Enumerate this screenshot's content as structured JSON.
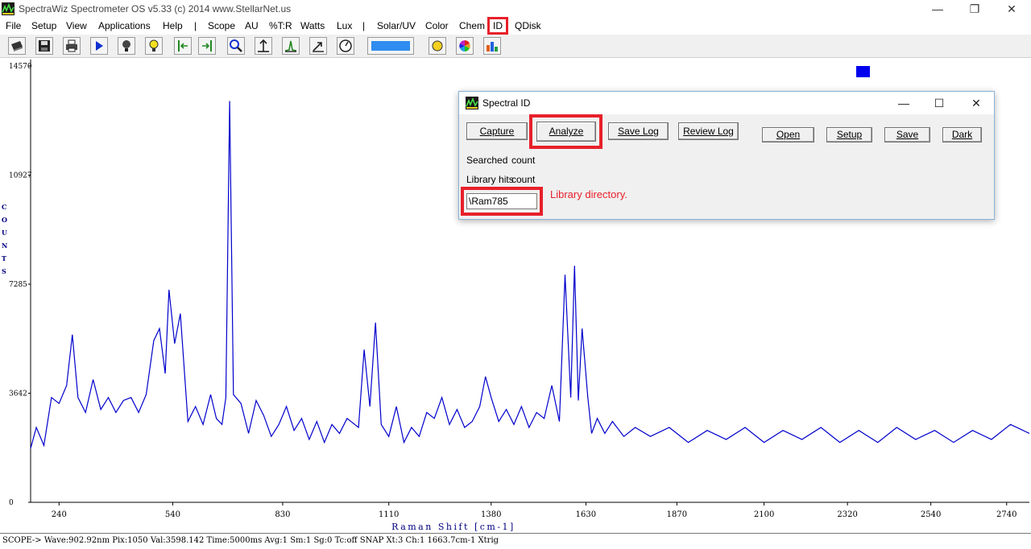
{
  "window": {
    "title": "SpectraWiz  Spectrometer OS v5.33 (c) 2014    www.StellarNet.us",
    "minimize_glyph": "—",
    "restore_glyph": "❐",
    "close_glyph": "✕"
  },
  "menu": {
    "items": [
      "File",
      "Setup",
      "View",
      "Applications",
      "Help",
      "|",
      "Scope",
      "AU",
      "%T:R",
      "Watts",
      "Lux",
      "|",
      "Solar/UV",
      "Color",
      "Chem",
      "ID",
      "QDisk"
    ],
    "highlighted": "ID"
  },
  "toolbar": {
    "icons": [
      "open-icon",
      "save-icon",
      "print-icon",
      "play-icon",
      "lamp-icon",
      "bulb-icon",
      "cursor-left-icon",
      "cursor-right-icon",
      "zoom-icon",
      "autoscale-icon",
      "peak-icon",
      "scale-up-icon",
      "gauge-icon",
      "color-bar-icon",
      "sun-icon",
      "color-wheel-icon",
      "chart-icon"
    ],
    "color_bar": "#2f8cf0"
  },
  "chart_data": {
    "type": "line",
    "xlabel": "Raman Shift [cm-1]",
    "ylabel": "COUNTS",
    "xlim": [
      165,
      2800
    ],
    "ylim": [
      0,
      14570
    ],
    "x_ticks": [
      240,
      540,
      830,
      1110,
      1380,
      1630,
      1870,
      2100,
      2320,
      2540,
      2740
    ],
    "y_ticks": [
      0,
      3642,
      7285,
      10927,
      14570
    ],
    "grid": false,
    "series": [
      {
        "color": "#0000cc",
        "x": [
          165,
          180,
          200,
          220,
          240,
          260,
          275,
          290,
          310,
          330,
          350,
          370,
          390,
          410,
          430,
          450,
          470,
          490,
          505,
          520,
          530,
          545,
          560,
          580,
          600,
          620,
          640,
          655,
          670,
          680,
          690,
          700,
          720,
          740,
          760,
          780,
          800,
          820,
          840,
          860,
          880,
          900,
          920,
          940,
          960,
          980,
          1000,
          1030,
          1045,
          1060,
          1075,
          1090,
          1110,
          1130,
          1150,
          1170,
          1190,
          1210,
          1230,
          1250,
          1270,
          1290,
          1310,
          1330,
          1350,
          1365,
          1380,
          1400,
          1420,
          1440,
          1460,
          1480,
          1500,
          1520,
          1540,
          1560,
          1575,
          1590,
          1600,
          1610,
          1620,
          1635,
          1645,
          1660,
          1680,
          1700,
          1730,
          1760,
          1800,
          1850,
          1900,
          1950,
          2000,
          2050,
          2100,
          2150,
          2200,
          2250,
          2300,
          2350,
          2400,
          2450,
          2500,
          2550,
          2600,
          2650,
          2700,
          2750,
          2800
        ],
        "values": [
          1800,
          2500,
          1900,
          3500,
          3300,
          3900,
          5600,
          3500,
          3000,
          4100,
          3100,
          3500,
          3000,
          3400,
          3500,
          3000,
          3600,
          5400,
          5800,
          4300,
          7100,
          5300,
          6300,
          2700,
          3200,
          2600,
          3600,
          2800,
          2600,
          3500,
          13400,
          3600,
          3300,
          2300,
          3400,
          2900,
          2200,
          2600,
          3200,
          2400,
          2800,
          2100,
          2700,
          2000,
          2600,
          2300,
          2800,
          2500,
          5100,
          3200,
          6000,
          2600,
          2200,
          3200,
          2000,
          2500,
          2200,
          3000,
          2800,
          3500,
          2600,
          3100,
          2500,
          2700,
          3200,
          4200,
          3500,
          2700,
          3100,
          2600,
          3200,
          2500,
          3000,
          2800,
          3900,
          2700,
          7600,
          3500,
          7900,
          3400,
          5800,
          3500,
          2300,
          2800,
          2300,
          2700,
          2200,
          2500,
          2200,
          2500,
          2000,
          2400,
          2100,
          2500,
          2000,
          2400,
          2100,
          2500,
          2000,
          2400,
          2000,
          2500,
          2100,
          2400,
          2000,
          2400,
          2100,
          2600,
          2300
        ]
      }
    ]
  },
  "marker_color": "#0000ee",
  "status": {
    "text": "SCOPE->  Wave:902.92nm  Pix:1050  Val:3598.142  Time:5000ms  Avg:1  Sm:1  Sg:0  Tc:off  SNAP  Xt:3  Ch:1   1663.7cm-1 Xtrig"
  },
  "dialog": {
    "title": "Spectral ID",
    "buttons": {
      "capture": "Capture",
      "analyze": "Analyze",
      "save_log": "Save Log",
      "review_log": "Review Log",
      "open": "Open",
      "setup": "Setup",
      "save": "Save",
      "dark": "Dark"
    },
    "searched_label": "Searched",
    "searched_value": "count",
    "hits_label": "Library hits",
    "hits_value": "count",
    "library_dir_value": "\\Ram785",
    "annotation": "Library directory."
  },
  "colors": {
    "highlight": "#e8202a",
    "trace": "#0000cc",
    "axis_text": "#000080"
  }
}
